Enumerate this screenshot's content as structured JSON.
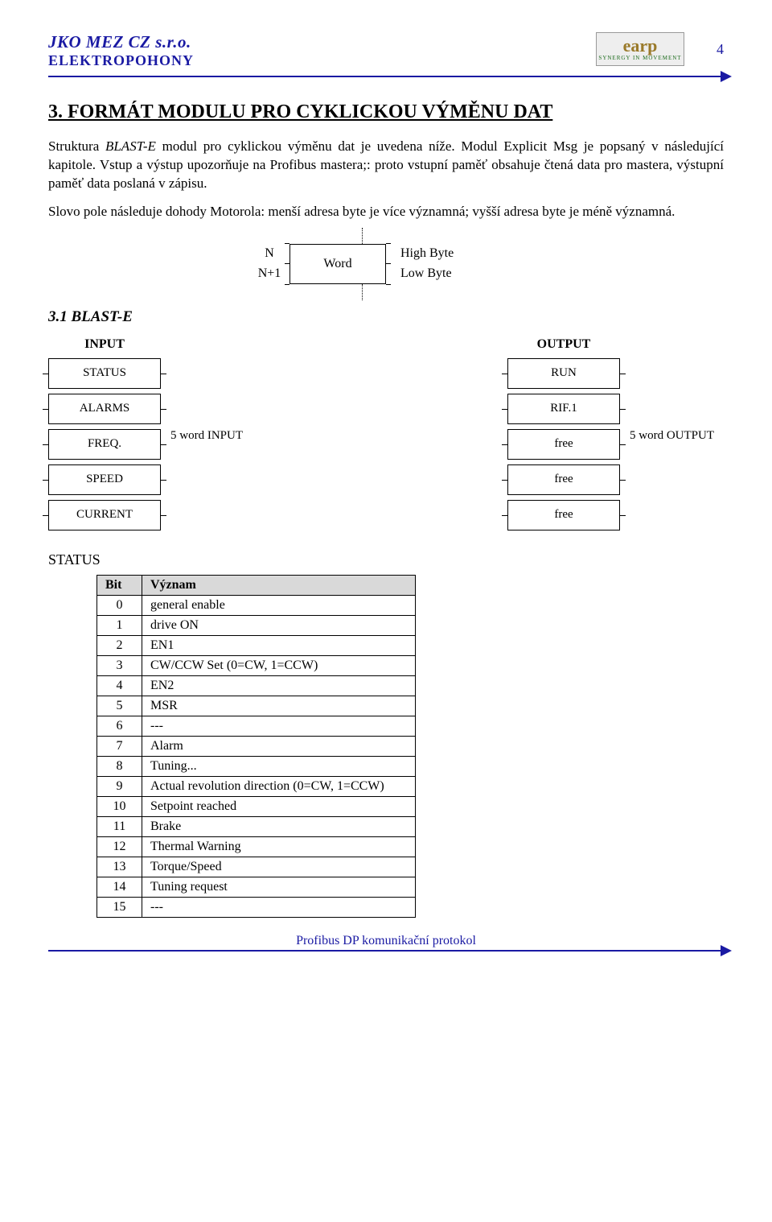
{
  "header": {
    "company_line": "JKO MEZ CZ s.r.o.",
    "subtitle": "ELEKTROPOHONY",
    "logo_top": "earp",
    "logo_bottom": "SYNERGY IN MOVEMENT",
    "page_number": "4"
  },
  "section": {
    "title": "3.  FORMÁT MODULU PRO CYKLICKOU VÝMĚNU DAT",
    "para1_a": "Struktura ",
    "para1_b": "BLAST-E",
    "para1_c": " modul pro cyklickou výměnu dat je uvedena níže. Modul Explicit Msg  je popsaný v následující kapitole. Vstup a  výstup upozorňuje na Profibus mastera;: proto  vstupní paměť obsahuje  čtená data pro mastera, výstupní paměť  data poslaná v zápisu.",
    "para2": "Slovo pole následuje dohody Motorola: menší adresa byte  je více významná; vyšší adresa byte je méně významná."
  },
  "word_diagram": {
    "n": "N",
    "n1": "N+1",
    "word": "Word",
    "high": "High Byte",
    "low": "Low Byte"
  },
  "sub": {
    "title": "3.1 BLAST-E",
    "input_head": "INPUT",
    "output_head": "OUTPUT",
    "input_cells": [
      "STATUS",
      "ALARMS",
      "FREQ.",
      "SPEED",
      "CURRENT"
    ],
    "input_side": "5 word INPUT",
    "output_cells": [
      "RUN",
      "RIF.1",
      "free",
      "free",
      "free"
    ],
    "output_side": "5 word OUTPUT"
  },
  "status": {
    "label": "STATUS",
    "head_bit": "Bit",
    "head_mean": "Význam",
    "rows": [
      {
        "bit": "0",
        "mean": "general enable"
      },
      {
        "bit": "1",
        "mean": "drive ON"
      },
      {
        "bit": "2",
        "mean": "EN1"
      },
      {
        "bit": "3",
        "mean": "CW/CCW Set (0=CW, 1=CCW)"
      },
      {
        "bit": "4",
        "mean": "EN2"
      },
      {
        "bit": "5",
        "mean": "MSR"
      },
      {
        "bit": "6",
        "mean": "---"
      },
      {
        "bit": "7",
        "mean": "Alarm"
      },
      {
        "bit": "8",
        "mean": "Tuning..."
      },
      {
        "bit": "9",
        "mean": "Actual revolution direction (0=CW, 1=CCW)"
      },
      {
        "bit": "10",
        "mean": "Setpoint reached"
      },
      {
        "bit": "11",
        "mean": "Brake"
      },
      {
        "bit": "12",
        "mean": "Thermal Warning"
      },
      {
        "bit": "13",
        "mean": "Torque/Speed"
      },
      {
        "bit": "14",
        "mean": "Tuning request"
      },
      {
        "bit": "15",
        "mean": "---"
      }
    ]
  },
  "footer": {
    "text": "Profibus DP  komunikační protokol"
  }
}
